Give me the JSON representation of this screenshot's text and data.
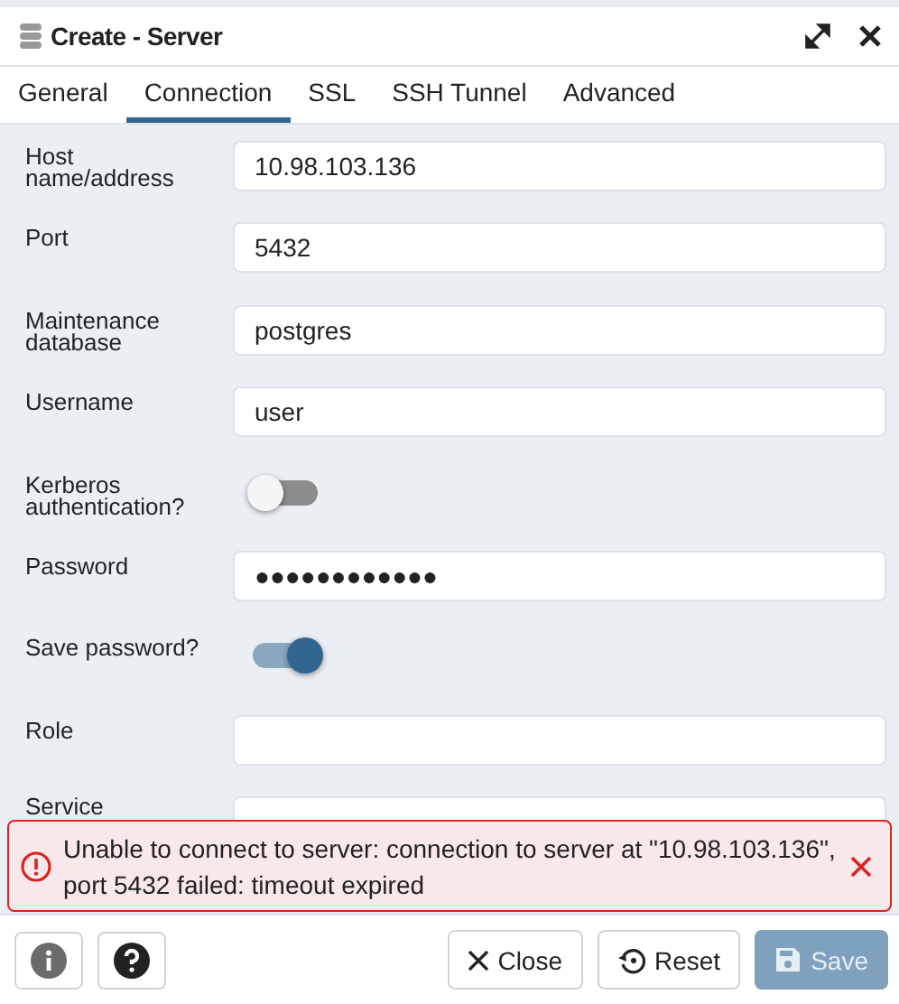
{
  "window": {
    "title": "Create - Server"
  },
  "tabs": [
    {
      "label": "General",
      "selected": false
    },
    {
      "label": "Connection",
      "selected": true
    },
    {
      "label": "SSL",
      "selected": false
    },
    {
      "label": "SSH Tunnel",
      "selected": false
    },
    {
      "label": "Advanced",
      "selected": false
    }
  ],
  "fields": [
    {
      "kind": "text",
      "label": "Host name/address",
      "value": "10.98.103.136"
    },
    {
      "kind": "text",
      "label": "Port",
      "value": "5432"
    },
    {
      "kind": "text",
      "label": "Maintenance database",
      "value": "postgres"
    },
    {
      "kind": "text",
      "label": "Username",
      "value": "user"
    },
    {
      "kind": "switch",
      "label": "Kerberos authentication?",
      "on": false
    },
    {
      "kind": "text",
      "label": "Password",
      "value": "●●●●●●●●●●●●"
    },
    {
      "kind": "switch",
      "label": "Save password?",
      "on": true
    },
    {
      "kind": "text",
      "label": "Role"
    },
    {
      "kind": "text",
      "label": "Service"
    }
  ],
  "alert": {
    "message": "Unable to connect to server: connection to server at \"10.98.103.136\", port 5432 failed: timeout expired"
  },
  "footer": {
    "buttons": [
      {
        "kind": "close",
        "label": "Close",
        "disabled": false
      },
      {
        "kind": "reset",
        "label": "Reset",
        "disabled": false
      },
      {
        "kind": "save",
        "label": "Save",
        "disabled": true
      }
    ]
  }
}
